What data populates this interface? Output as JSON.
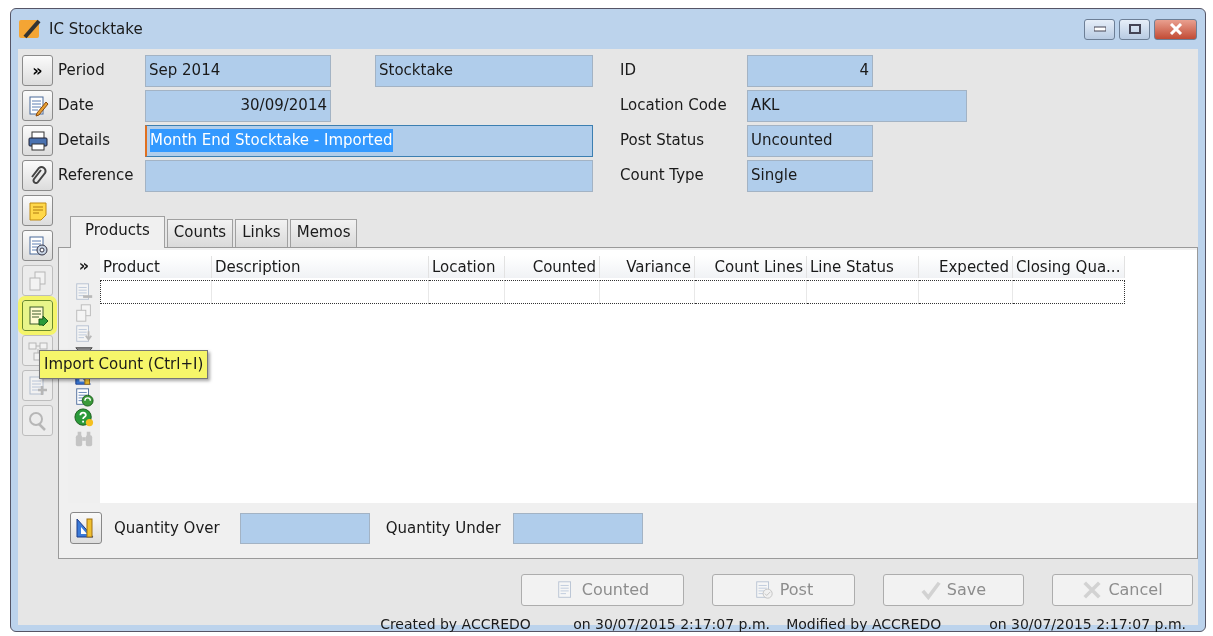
{
  "window": {
    "title": "IC Stocktake"
  },
  "toolbar": [
    {
      "kind": "expand",
      "label": "»",
      "disabled": false,
      "highlighted": false
    },
    {
      "kind": "edit",
      "disabled": false,
      "highlighted": false
    },
    {
      "kind": "print",
      "disabled": false,
      "highlighted": false
    },
    {
      "kind": "attach",
      "disabled": false,
      "highlighted": false
    },
    {
      "kind": "note",
      "disabled": false,
      "highlighted": false
    },
    {
      "kind": "settings",
      "disabled": false,
      "highlighted": false
    },
    {
      "kind": "copy",
      "disabled": true,
      "highlighted": false
    },
    {
      "kind": "import",
      "disabled": false,
      "highlighted": true
    },
    {
      "kind": "link",
      "disabled": true,
      "highlighted": false
    },
    {
      "kind": "add",
      "disabled": true,
      "highlighted": false
    },
    {
      "kind": "search",
      "disabled": true,
      "highlighted": false
    }
  ],
  "tooltip": {
    "text": "Import Count (Ctrl+I)"
  },
  "form_rows": [
    {
      "label": "Period",
      "value": "Sep 2014",
      "right_aligned": false,
      "extra": "Stocktake",
      "selected": false,
      "right_label": "ID",
      "right_value": "4",
      "right_value_right_aligned": true
    },
    {
      "label": "Date",
      "value": "30/09/2014",
      "right_aligned": true,
      "selected": false,
      "right_label": "Location Code",
      "right_value": "AKL",
      "right_value_right_aligned": false
    },
    {
      "label": "Details",
      "value": "Month End Stocktake - Imported",
      "right_aligned": false,
      "selected": true,
      "right_label": "Post Status",
      "right_value": "Uncounted",
      "right_value_right_aligned": false
    },
    {
      "label": "Reference",
      "right_aligned": false,
      "selected": false,
      "right_label": "Count Type",
      "right_value": "Single",
      "right_value_right_aligned": false
    }
  ],
  "tabs": [
    {
      "label": "Products",
      "selected": true
    },
    {
      "label": "Counts",
      "selected": false
    },
    {
      "label": "Links",
      "selected": false
    },
    {
      "label": "Memos",
      "selected": false
    }
  ],
  "grid": {
    "expand_label": "»",
    "row_icons": [
      {
        "kind": "remove",
        "disabled": true
      },
      {
        "kind": "copy",
        "disabled": true
      },
      {
        "kind": "insert",
        "disabled": true
      },
      {
        "kind": "filter",
        "disabled": false
      },
      {
        "kind": "ruler",
        "disabled": false
      },
      {
        "kind": "refresh",
        "disabled": false
      },
      {
        "kind": "help",
        "disabled": false
      },
      {
        "kind": "find",
        "disabled": true
      }
    ],
    "columns": [
      {
        "label": "Product",
        "right_aligned": false
      },
      {
        "label": "Description",
        "right_aligned": false
      },
      {
        "label": "Location",
        "right_aligned": false
      },
      {
        "label": "Counted",
        "right_aligned": true
      },
      {
        "label": "Variance",
        "right_aligned": true
      },
      {
        "label": "Count Lines",
        "right_aligned": true
      },
      {
        "label": "Line Status",
        "right_aligned": false
      },
      {
        "label": "Expected",
        "right_aligned": true
      },
      {
        "label": "Closing Qua...",
        "right_aligned": false
      }
    ],
    "rows": [
      {
        "focused": true
      }
    ]
  },
  "quantity": [
    {
      "label": "Quantity Over"
    },
    {
      "label": "Quantity Under"
    }
  ],
  "buttons": [
    {
      "kind": "counted",
      "label": "Counted",
      "disabled": true
    },
    {
      "kind": "post",
      "label": "Post",
      "disabled": true
    },
    {
      "kind": "save",
      "label": "Save",
      "disabled": true
    },
    {
      "kind": "cancel",
      "label": "Cancel",
      "disabled": true
    }
  ],
  "status_bar": [
    "Created by ACCREDO",
    "on 30/07/2015 2:17:07 p.m.",
    "Modified by ACCREDO",
    "on 30/07/2015 2:17:07 p.m."
  ]
}
